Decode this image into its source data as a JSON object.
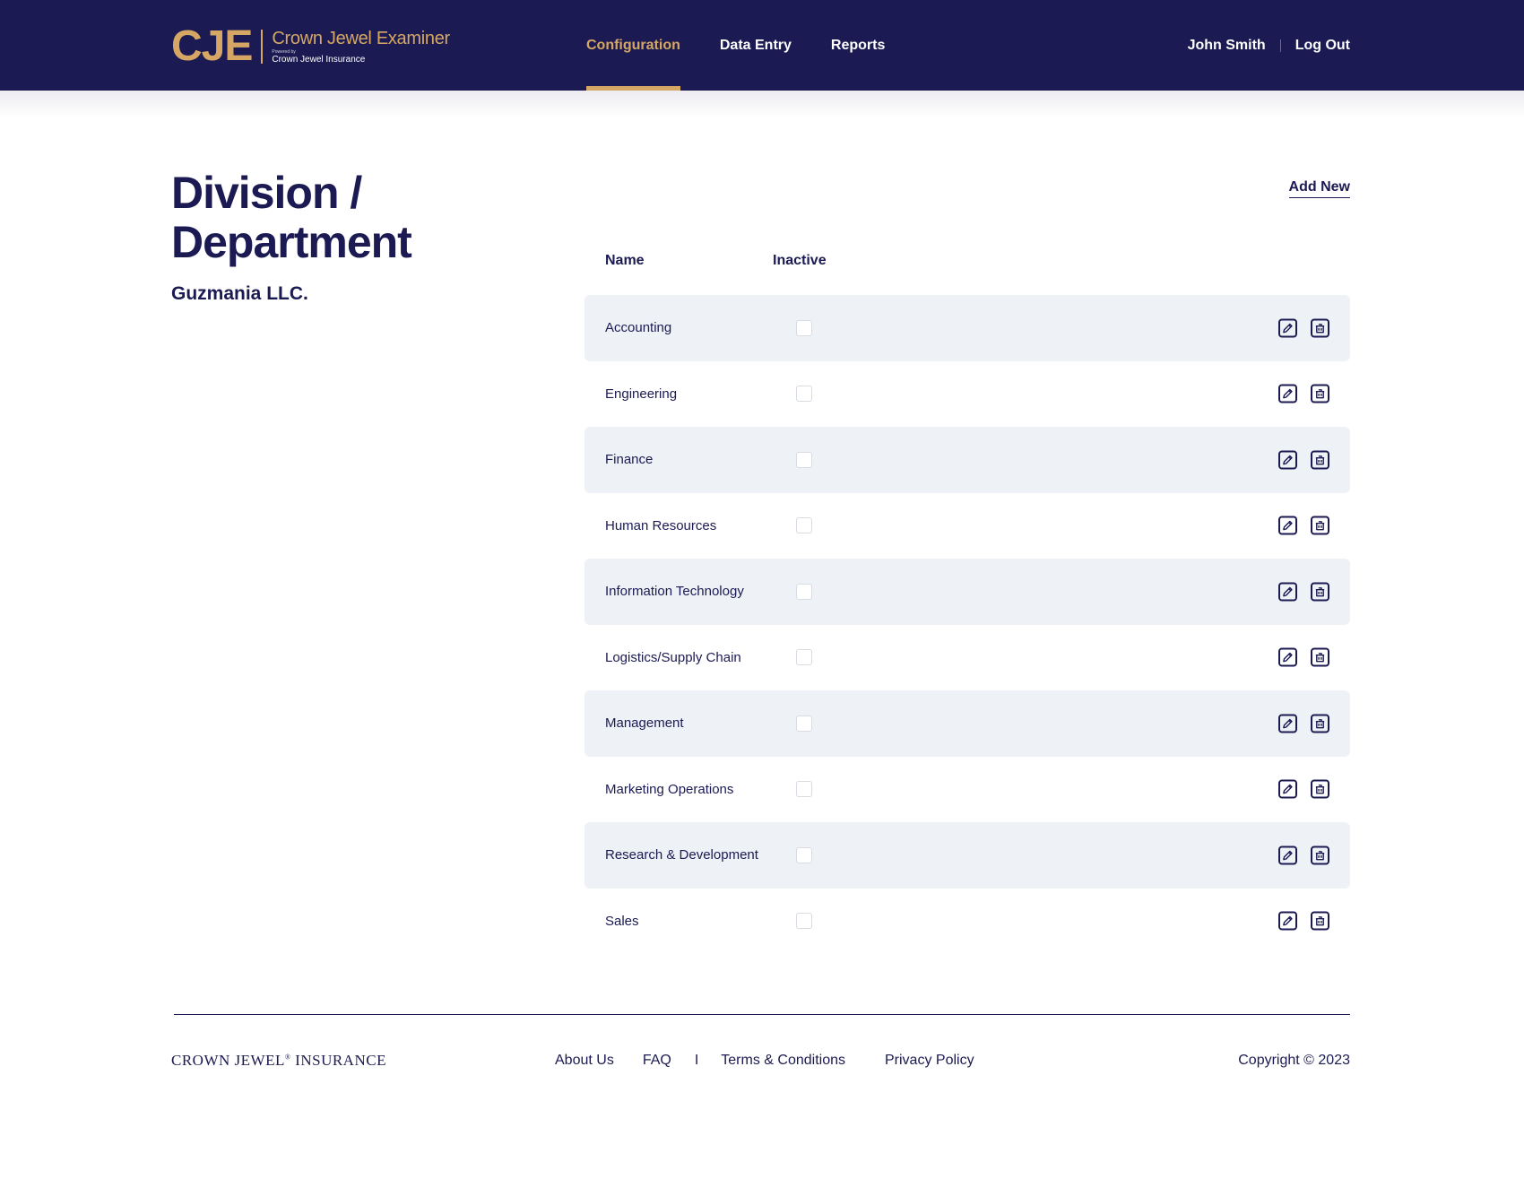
{
  "brand": {
    "mark": "CJE",
    "title": "Crown Jewel Examiner",
    "powered_by": "Powered by",
    "subtitle": "Crown Jewel Insurance"
  },
  "nav": {
    "items": [
      {
        "label": "Configuration",
        "active": true
      },
      {
        "label": "Data Entry",
        "active": false
      },
      {
        "label": "Reports",
        "active": false
      }
    ]
  },
  "user": {
    "name": "John Smith",
    "logout_label": "Log Out"
  },
  "page": {
    "title": "Division / Department",
    "company": "Guzmania LLC.",
    "add_new_label": "Add New"
  },
  "table": {
    "headers": {
      "name": "Name",
      "inactive": "Inactive"
    },
    "rows": [
      {
        "name": "Accounting",
        "inactive": false
      },
      {
        "name": "Engineering",
        "inactive": false
      },
      {
        "name": "Finance",
        "inactive": false
      },
      {
        "name": "Human Resources",
        "inactive": false
      },
      {
        "name": "Information Technology",
        "inactive": false
      },
      {
        "name": "Logistics/Supply Chain",
        "inactive": false
      },
      {
        "name": "Management",
        "inactive": false
      },
      {
        "name": "Marketing Operations",
        "inactive": false
      },
      {
        "name": "Research & Development",
        "inactive": false
      },
      {
        "name": "Sales",
        "inactive": false
      }
    ]
  },
  "footer": {
    "brand_left": "CROWN JEWEL",
    "brand_mark": "®",
    "brand_right": " INSURANCE",
    "links": {
      "about": "About Us",
      "faq": "FAQ",
      "sep": "I",
      "terms": "Terms & Conditions",
      "privacy": "Privacy Policy"
    },
    "copyright": "Copyright © 2023"
  },
  "colors": {
    "navy": "#1b1a52",
    "gold": "#d6a764",
    "row_stripe": "#eef2f7"
  },
  "icons": {
    "edit": "edit-icon",
    "delete": "delete-icon"
  }
}
